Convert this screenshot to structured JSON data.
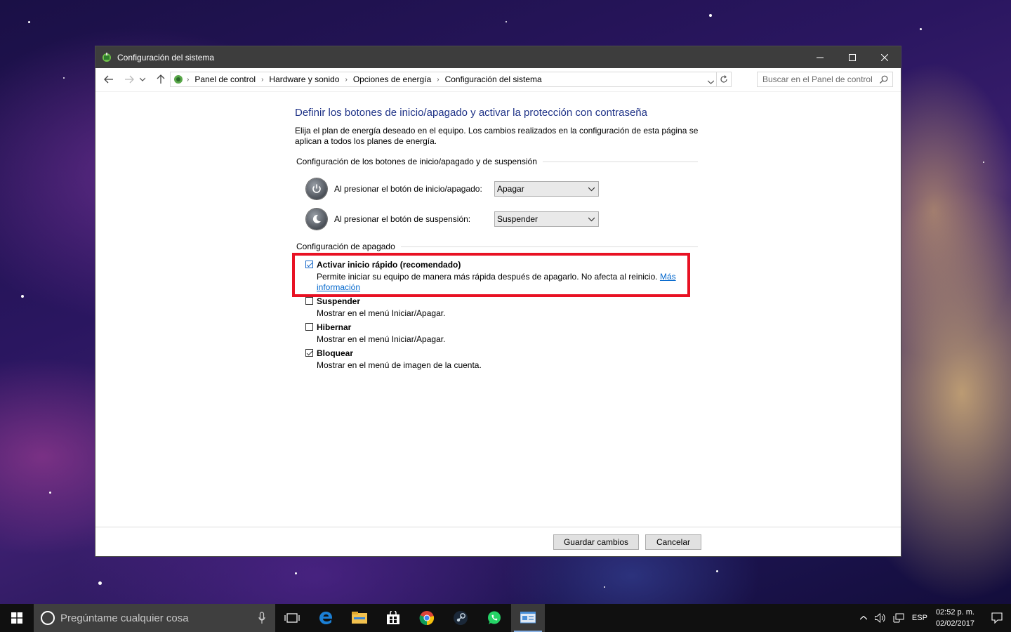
{
  "window": {
    "title": "Configuración del sistema"
  },
  "address": {
    "crumbs": [
      "Panel de control",
      "Hardware y sonido",
      "Opciones de energía",
      "Configuración del sistema"
    ],
    "search_placeholder": "Buscar en el Panel de control"
  },
  "page": {
    "heading": "Definir los botones de inicio/apagado y activar la protección con contraseña",
    "description": "Elija el plan de energía deseado en el equipo. Los cambios realizados en la configuración de esta página se aplican a todos los planes de energía.",
    "section_buttons": "Configuración de los botones de inicio/apagado y de suspensión",
    "power_button_label": "Al presionar el botón de inicio/apagado:",
    "power_button_value": "Apagar",
    "sleep_button_label": "Al presionar el botón de suspensión:",
    "sleep_button_value": "Suspender",
    "section_shutdown": "Configuración de apagado",
    "options": [
      {
        "title": "Activar inicio rápido (recomendado)",
        "desc": "Permite iniciar su equipo de manera más rápida después de apagarlo. No afecta al reinicio.",
        "link": "Más",
        "link2": "información",
        "checked": true
      },
      {
        "title": "Suspender",
        "desc": "Mostrar en el menú Iniciar/Apagar.",
        "checked": false
      },
      {
        "title": "Hibernar",
        "desc": "Mostrar en el menú Iniciar/Apagar.",
        "checked": false
      },
      {
        "title": "Bloquear",
        "desc": "Mostrar en el menú de imagen de la cuenta.",
        "checked": true
      }
    ],
    "save_label": "Guardar cambios",
    "cancel_label": "Cancelar"
  },
  "taskbar": {
    "search_placeholder": "Pregúntame cualquier cosa",
    "apps": [
      "task-view-icon",
      "edge-icon",
      "file-explorer-icon",
      "store-icon",
      "chrome-icon",
      "steam-icon",
      "whatsapp-icon",
      "control-panel-icon"
    ],
    "language": "ESP",
    "time": "02:52 p. m.",
    "date": "02/02/2017"
  },
  "colors": {
    "heading_blue": "#1e3287",
    "highlight_red": "#e81123",
    "link_blue": "#0066cc"
  }
}
